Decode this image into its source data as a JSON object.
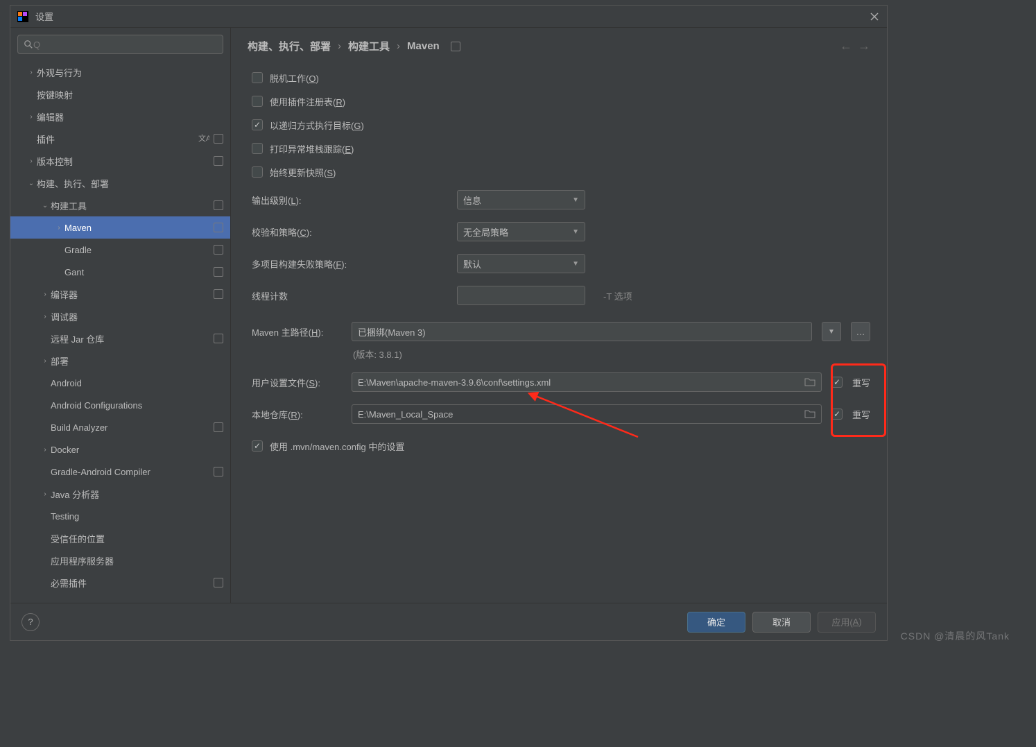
{
  "window": {
    "title": "设置"
  },
  "search": {
    "placeholder": "Q"
  },
  "sidebar": {
    "items": [
      {
        "label": "外观与行为",
        "arrow": ">",
        "indent": 0
      },
      {
        "label": "按键映射",
        "arrow": "",
        "indent": 0
      },
      {
        "label": "编辑器",
        "arrow": ">",
        "indent": 0
      },
      {
        "label": "插件",
        "arrow": "",
        "indent": 0,
        "lang": true,
        "marker": true
      },
      {
        "label": "版本控制",
        "arrow": ">",
        "indent": 0,
        "marker": true
      },
      {
        "label": "构建、执行、部署",
        "arrow": "∨",
        "indent": 0
      },
      {
        "label": "构建工具",
        "arrow": "∨",
        "indent": 1,
        "marker": true
      },
      {
        "label": "Maven",
        "arrow": ">",
        "indent": 2,
        "selected": true,
        "marker": true
      },
      {
        "label": "Gradle",
        "arrow": "",
        "indent": 2,
        "marker": true
      },
      {
        "label": "Gant",
        "arrow": "",
        "indent": 2,
        "marker": true
      },
      {
        "label": "编译器",
        "arrow": ">",
        "indent": 1,
        "marker": true
      },
      {
        "label": "调试器",
        "arrow": ">",
        "indent": 1
      },
      {
        "label": "远程 Jar 仓库",
        "arrow": "",
        "indent": 1,
        "marker": true
      },
      {
        "label": "部署",
        "arrow": ">",
        "indent": 1
      },
      {
        "label": "Android",
        "arrow": "",
        "indent": 1
      },
      {
        "label": "Android Configurations",
        "arrow": "",
        "indent": 1
      },
      {
        "label": "Build Analyzer",
        "arrow": "",
        "indent": 1,
        "marker": true
      },
      {
        "label": "Docker",
        "arrow": ">",
        "indent": 1
      },
      {
        "label": "Gradle-Android Compiler",
        "arrow": "",
        "indent": 1,
        "marker": true
      },
      {
        "label": "Java 分析器",
        "arrow": ">",
        "indent": 1
      },
      {
        "label": "Testing",
        "arrow": "",
        "indent": 1
      },
      {
        "label": "受信任的位置",
        "arrow": "",
        "indent": 1
      },
      {
        "label": "应用程序服务器",
        "arrow": "",
        "indent": 1
      },
      {
        "label": "必需插件",
        "arrow": "",
        "indent": 1,
        "marker": true
      }
    ]
  },
  "breadcrumb": {
    "level0": "构建、执行、部署",
    "level1": "构建工具",
    "level2": "Maven"
  },
  "checks": {
    "offline": {
      "pre": "脱机工作(",
      "ul": "O",
      "post": ")",
      "on": false
    },
    "registry": {
      "pre": "使用插件注册表(",
      "ul": "R",
      "post": ")",
      "on": false
    },
    "recursive": {
      "pre": "以递归方式执行目标(",
      "ul": "G",
      "post": ")",
      "on": true
    },
    "trace": {
      "pre": "打印异常堆栈跟踪(",
      "ul": "E",
      "post": ")",
      "on": false
    },
    "snapshot": {
      "pre": "始终更新快照(",
      "ul": "S",
      "post": ")",
      "on": false
    },
    "mvnconfig": {
      "label": "使用 .mvn/maven.config 中的设置",
      "on": true
    }
  },
  "fields": {
    "outputLevel": {
      "label_pre": "输出级别(",
      "ul": "L",
      "label_post": "):",
      "value": "信息"
    },
    "checksum": {
      "label_pre": "校验和策略(",
      "ul": "C",
      "label_post": "):",
      "value": "无全局策略"
    },
    "failPolicy": {
      "label_pre": "多项目构建失败策略(",
      "ul": "F",
      "label_post": "):",
      "value": "默认"
    },
    "threads": {
      "label": "线程计数",
      "value": "",
      "hint": "-T 选项"
    },
    "mavenHome": {
      "label_pre": "Maven 主路径(",
      "ul": "H",
      "label_post": "):",
      "value": "已捆绑(Maven 3)"
    },
    "version": "(版本: 3.8.1)",
    "userSettings": {
      "label_pre": "用户设置文件(",
      "ul": "S",
      "label_post": "):",
      "value": "E:\\Maven\\apache-maven-3.9.6\\conf\\settings.xml"
    },
    "localRepo": {
      "label_pre": "本地仓库(",
      "ul": "R",
      "label_post": "):",
      "value": "E:\\Maven_Local_Space"
    },
    "overwrite1": {
      "label": "重写",
      "on": true
    },
    "overwrite2": {
      "label": "重写",
      "on": true
    }
  },
  "footer": {
    "ok": "确定",
    "cancel": "取消",
    "apply_pre": "应用(",
    "apply_ul": "A",
    "apply_post": ")"
  },
  "watermark": "CSDN @清晨的风Tank"
}
